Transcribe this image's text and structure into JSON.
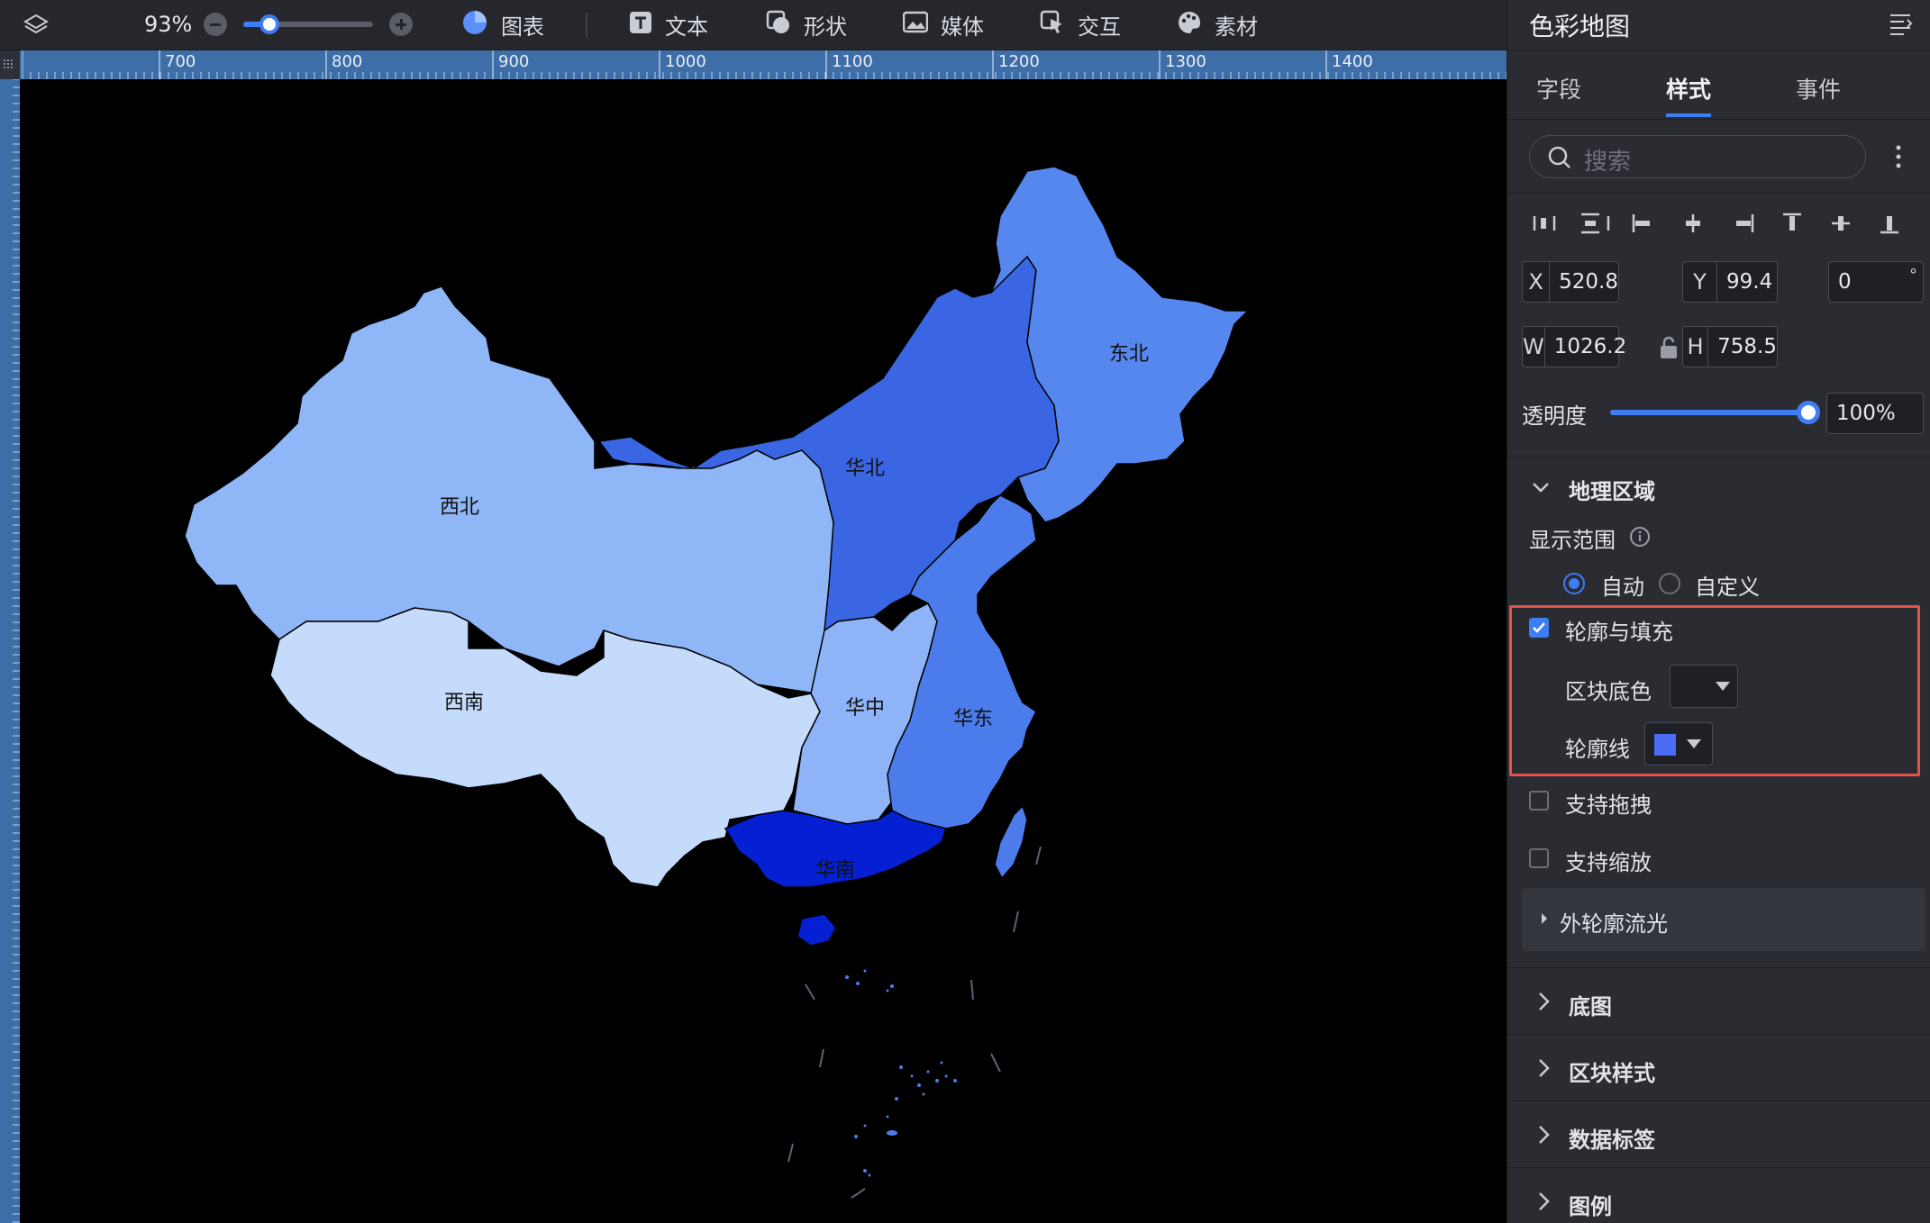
{
  "toolbar": {
    "zoom": "93%",
    "zoom_level": 0.2,
    "tools": [
      {
        "label": "图表",
        "icon": "pie-chart-icon"
      },
      {
        "label": "文本",
        "icon": "text-icon"
      },
      {
        "label": "形状",
        "icon": "shape-icon"
      },
      {
        "label": "媒体",
        "icon": "image-icon"
      },
      {
        "label": "交互",
        "icon": "interaction-icon"
      },
      {
        "label": "素材",
        "icon": "palette-icon"
      }
    ]
  },
  "ruler": {
    "labels": [
      "700",
      "800",
      "900",
      "1000",
      "1100",
      "1200",
      "1300",
      "1400"
    ]
  },
  "map": {
    "regions": [
      {
        "name": "西北",
        "color": "#8fb6f7"
      },
      {
        "name": "华北",
        "color": "#3a66e4"
      },
      {
        "name": "东北",
        "color": "#5687ee"
      },
      {
        "name": "西南",
        "color": "#c4dbfc"
      },
      {
        "name": "华中",
        "color": "#8eb4f7"
      },
      {
        "name": "华东",
        "color": "#4c7ceb"
      },
      {
        "name": "华南",
        "color": "#0520d3"
      }
    ]
  },
  "panel": {
    "title": "色彩地图",
    "tabs": [
      "字段",
      "样式",
      "事件"
    ],
    "active_tab": "样式",
    "search_placeholder": "搜索",
    "x_label": "X",
    "x_value": "520.8",
    "y_label": "Y",
    "y_value": "99.4",
    "rotation_value": "0",
    "rotation_unit": "°",
    "w_label": "W",
    "w_value": "1026.2",
    "h_label": "H",
    "h_value": "758.5",
    "opacity_label": "透明度",
    "opacity_value": "100%",
    "opacity_level": 1.0,
    "geo_section": "地理区域",
    "display_range_label": "显示范围",
    "radio_auto": "自动",
    "radio_custom": "自定义",
    "outline_fill_label": "轮廓与填充",
    "block_color_label": "区块底色",
    "outline_line_label": "轮廓线",
    "outline_color": "#4d6cf5",
    "drag_label": "支持拖拽",
    "zoom_label": "支持缩放",
    "glow_label": "外轮廓流光",
    "sections": [
      "底图",
      "区块样式",
      "数据标签",
      "图例"
    ],
    "accent": "#3d7df6",
    "highlight_border": "#e5524a"
  }
}
